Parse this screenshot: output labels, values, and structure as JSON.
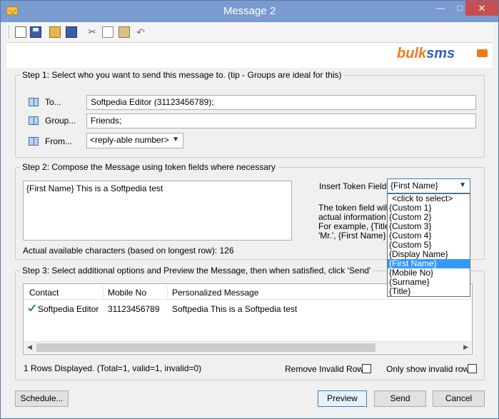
{
  "window": {
    "title": "Message 2",
    "min_glyph": "—",
    "max_glyph": "□",
    "close_glyph": "✕"
  },
  "toolbar": {
    "icons": [
      "new-document-icon",
      "save-icon",
      "open-folder-icon",
      "save-all-icon",
      "cut-icon",
      "copy-icon",
      "paste-icon",
      "undo-icon"
    ],
    "cut_glyph": "✂",
    "undo_glyph": "↶"
  },
  "logo": {
    "part1": "bulk",
    "part2": "sms"
  },
  "step1": {
    "legend": "Step 1: Select who you want to send this message to. (tip - Groups are ideal for this)",
    "to_label": "To...",
    "to_value": "Softpedia Editor (31123456789);",
    "group_label": "Group...",
    "group_value": "Friends;",
    "from_label": "From...",
    "from_value": "<reply-able number>"
  },
  "step2": {
    "legend": "Step 2: Compose the Message using token fields where necessary",
    "message": "{First Name} This is a Softpedia test",
    "insert_token_label": "Insert Token Field:",
    "insert_token_value": "{First Name}",
    "token_info": [
      "The token field will b",
      "actual information th",
      "For example, {Title}",
      "'Mr.', {First Name} w"
    ],
    "available_chars": "Actual available characters (based on longest row): 126"
  },
  "token_dropdown": {
    "options": [
      "<click to select>",
      "{Custom 1}",
      "{Custom 2}",
      "{Custom 3}",
      "{Custom 4}",
      "{Custom 5}",
      "{Display Name}",
      "{First Name}",
      "{Mobile No}",
      "{Surname}",
      "{Title}"
    ],
    "selected_index": 7
  },
  "step3": {
    "legend": "Step 3: Select additional options and Preview the Message, then when satisfied, click 'Send'",
    "columns": [
      "Contact",
      "Mobile No",
      "Personalized Message"
    ],
    "rows": [
      {
        "contact": "Softpedia Editor",
        "mobile": "31123456789",
        "message": "Softpedia This is a Softpedia test",
        "valid": true
      }
    ],
    "status": "1 Rows Displayed.  (Total=1, valid=1, invalid=0)",
    "remove_invalid_label": "Remove Invalid Rows",
    "remove_invalid_checked": false,
    "only_invalid_label": "Only show invalid rows",
    "only_invalid_checked": false
  },
  "buttons": {
    "schedule": "Schedule...",
    "preview": "Preview",
    "send": "Send",
    "cancel": "Cancel"
  },
  "colors": {
    "titlebar": "#7a9bd0",
    "close": "#c74f4f",
    "selection": "#3399ff",
    "brand_orange": "#f07a1a",
    "brand_blue": "#2d63b8",
    "valid_check": "#2a8a2a"
  }
}
